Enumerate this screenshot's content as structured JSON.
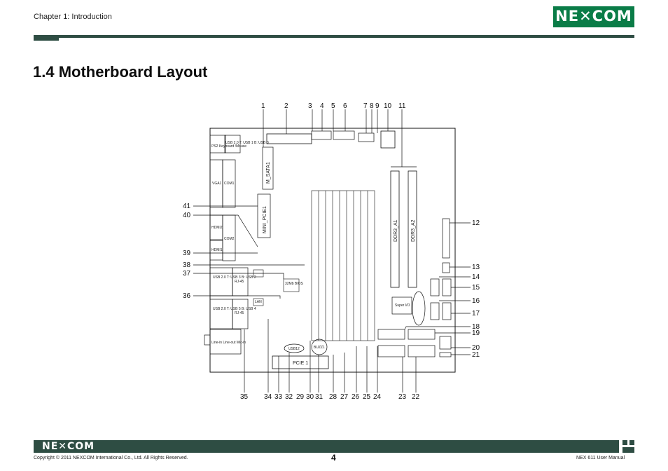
{
  "header": {
    "chapter": "Chapter 1: Introduction",
    "logo_text": "NE✕COM"
  },
  "page_title": "1.4 Motherboard Layout",
  "board": {
    "board_labels": {
      "ps2": "PS2 Keyboard /Mouse",
      "usb_top": "USB 2.0 T: USB 1 B: USB 0",
      "vga": "VGA1",
      "com1": "COM1",
      "msata": "M_SATA1",
      "mini_pcie": "MINI_PCIE1",
      "hdmi2": "HDMI2",
      "com2": "COM2",
      "hdmi1": "HDMI1",
      "usb_mid": "USB 2.0 T: USB 3 B: USB 2",
      "rj45_1": "RJ-45",
      "usb_bot": "USB 2.0 T: USB 5 B: USB 4",
      "rj45_2": "RJ-45",
      "lan": "LAN",
      "bios": "32Mb BIOS",
      "ddr3_a1": "DDR3_A1",
      "ddr3_a2": "DDR3_A2",
      "super_io": "Super I/O",
      "buzz": "BUZZ1",
      "pcie": "PCIE 1",
      "usb12": "USB12",
      "audio": "Line-in Line-out Mic-in"
    },
    "callouts": [
      "1",
      "2",
      "3",
      "4",
      "5",
      "6",
      "7",
      "8",
      "9",
      "10",
      "11",
      "12",
      "13",
      "14",
      "15",
      "16",
      "17",
      "18",
      "19",
      "20",
      "21",
      "22",
      "23",
      "24",
      "25",
      "26",
      "27",
      "28",
      "29",
      "30",
      "31",
      "32",
      "33",
      "34",
      "35",
      "36",
      "37",
      "38",
      "39",
      "40",
      "41"
    ]
  },
  "footer": {
    "logo_text": "NE✕COM",
    "copyright": "Copyright © 2011 NEXCOM International Co., Ltd. All Rights Reserved.",
    "page_number": "4",
    "manual": "NEX 611 User Manual"
  },
  "colors": {
    "brand_green": "#0a7c47",
    "rule_dark": "#2e4d43"
  }
}
